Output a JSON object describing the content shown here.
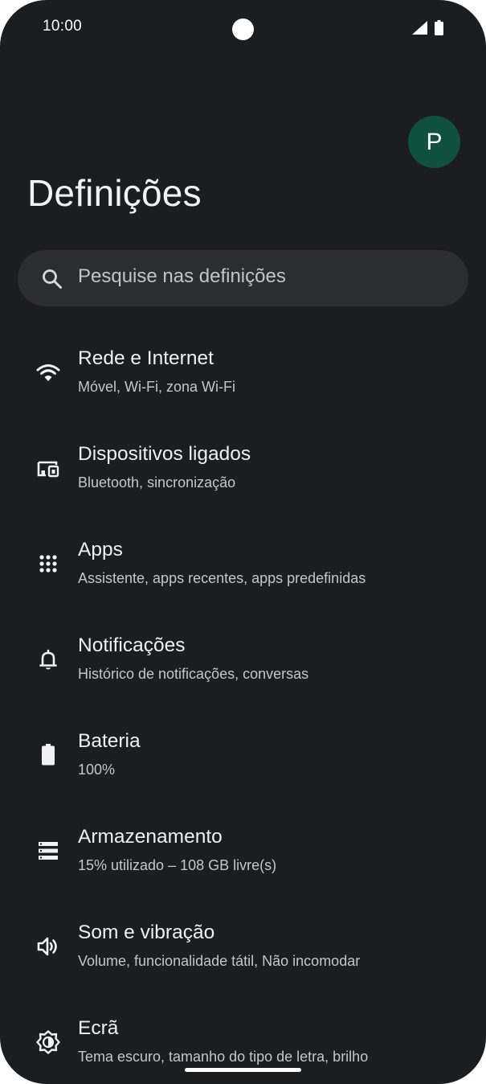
{
  "status_bar": {
    "time": "10:00"
  },
  "header": {
    "avatar_letter": "P",
    "title": "Definições"
  },
  "search": {
    "placeholder": "Pesquise nas definições"
  },
  "items": [
    {
      "icon": "wifi-icon",
      "title": "Rede e Internet",
      "subtitle": "Móvel, Wi-Fi, zona Wi-Fi"
    },
    {
      "icon": "connected-devices-icon",
      "title": "Dispositivos ligados",
      "subtitle": "Bluetooth, sincronização"
    },
    {
      "icon": "apps-grid-icon",
      "title": "Apps",
      "subtitle": "Assistente, apps recentes, apps predefinidas"
    },
    {
      "icon": "bell-icon",
      "title": "Notificações",
      "subtitle": "Histórico de notificações, conversas"
    },
    {
      "icon": "battery-icon",
      "title": "Bateria",
      "subtitle": "100%"
    },
    {
      "icon": "storage-icon",
      "title": "Armazenamento",
      "subtitle": "15% utilizado – 108 GB livre(s)"
    },
    {
      "icon": "speaker-icon",
      "title": "Som e vibração",
      "subtitle": "Volume, funcionalidade tátil, Não incomodar"
    },
    {
      "icon": "brightness-icon",
      "title": "Ecrã",
      "subtitle": "Tema escuro, tamanho do tipo de letra, brilho"
    }
  ],
  "colors": {
    "background": "#1b1d20",
    "search_background": "#2a2d31",
    "avatar_background": "#0f5040",
    "text_primary": "#eef0f2",
    "text_secondary": "#c4c6ca"
  }
}
